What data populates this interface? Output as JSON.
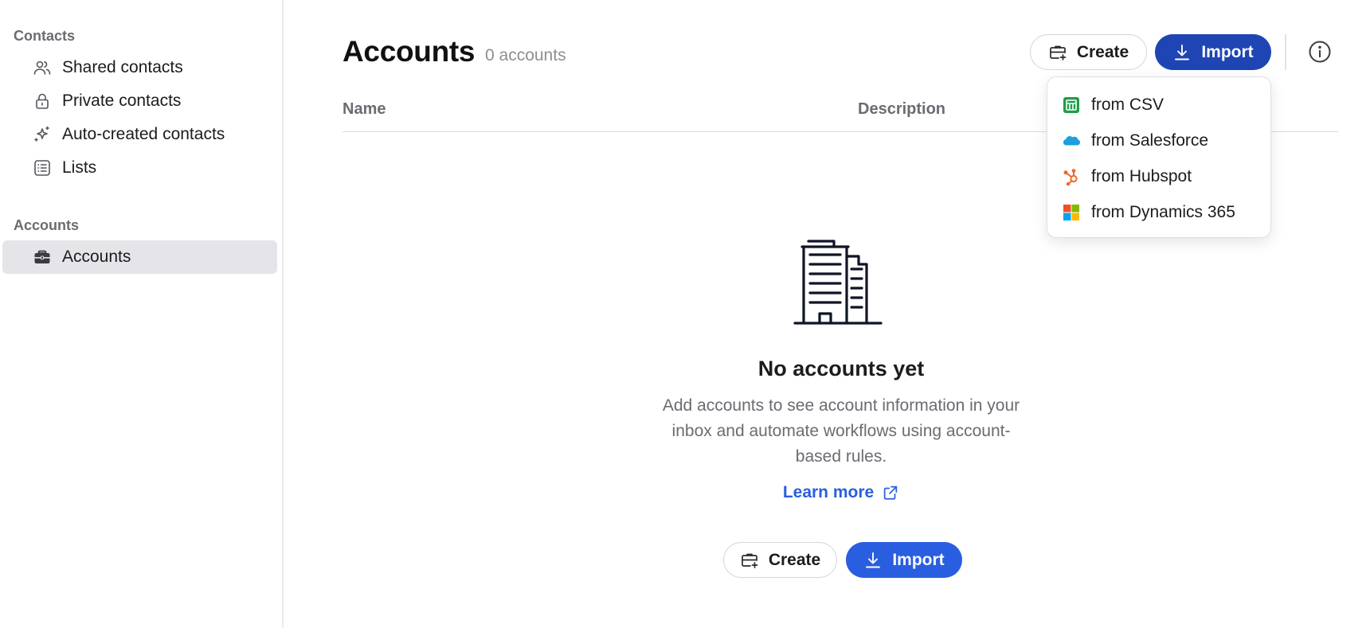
{
  "sidebar": {
    "contacts_section": "Contacts",
    "contacts_items": [
      {
        "label": "Shared contacts",
        "icon": "people-icon"
      },
      {
        "label": "Private contacts",
        "icon": "lock-icon"
      },
      {
        "label": "Auto-created contacts",
        "icon": "sparkles-icon"
      },
      {
        "label": "Lists",
        "icon": "list-icon"
      }
    ],
    "accounts_section": "Accounts",
    "accounts_items": [
      {
        "label": "Accounts",
        "icon": "briefcase-icon",
        "active": true
      }
    ]
  },
  "header": {
    "title": "Accounts",
    "count": "0 accounts",
    "create_label": "Create",
    "import_label": "Import"
  },
  "table": {
    "columns": [
      "Name",
      "Description"
    ]
  },
  "import_menu": {
    "items": [
      {
        "label": "from CSV",
        "icon": "csv-icon"
      },
      {
        "label": "from Salesforce",
        "icon": "salesforce-icon"
      },
      {
        "label": "from Hubspot",
        "icon": "hubspot-icon"
      },
      {
        "label": "from Dynamics 365",
        "icon": "microsoft-icon"
      }
    ]
  },
  "empty_state": {
    "title": "No accounts yet",
    "description": "Add accounts to see account information in your inbox and automate workflows using account-based rules.",
    "learn_more": "Learn more",
    "create_label": "Create",
    "import_label": "Import"
  },
  "colors": {
    "primary": "#1f45b5",
    "primary_bright": "#2a5ee0",
    "active_nav": "#e4e4e9",
    "muted_text": "#6b6b72"
  }
}
